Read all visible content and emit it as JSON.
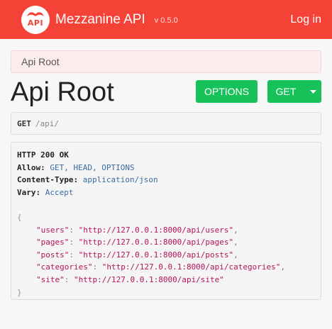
{
  "navbar": {
    "logo_text": "API",
    "brand_name": "Mezzanine API",
    "version": "v 0.5.0",
    "login_label": "Log in",
    "color": "#f44336"
  },
  "breadcrumb": {
    "label": "Api Root"
  },
  "page": {
    "title": "Api Root"
  },
  "buttons": {
    "options_label": "OPTIONS",
    "get_label": "GET",
    "color": "#18c25a"
  },
  "request": {
    "method": "GET",
    "path": "/api/"
  },
  "response": {
    "status": "HTTP 200 OK",
    "headers": [
      {
        "name": "Allow:",
        "value": "GET, HEAD, OPTIONS"
      },
      {
        "name": "Content-Type:",
        "value": "application/json"
      },
      {
        "name": "Vary:",
        "value": "Accept"
      }
    ],
    "open_brace": "{",
    "close_brace": "}",
    "body": [
      {
        "key": "\"users\"",
        "value": "\"http://127.0.0.1:8000/api/users\"",
        "end": ","
      },
      {
        "key": "\"pages\"",
        "value": "\"http://127.0.0.1:8000/api/pages\"",
        "end": ","
      },
      {
        "key": "\"posts\"",
        "value": "\"http://127.0.0.1:8000/api/posts\"",
        "end": ","
      },
      {
        "key": "\"categories\"",
        "value": "\"http://127.0.0.1:8000/api/categories\"",
        "end": ","
      },
      {
        "key": "\"site\"",
        "value": "\"http://127.0.0.1:8000/api/site\"",
        "end": ""
      }
    ]
  }
}
